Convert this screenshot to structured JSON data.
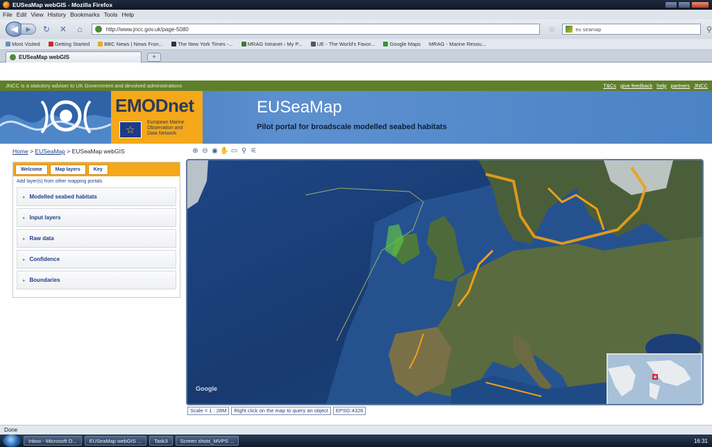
{
  "window": {
    "title": "EUSeaMap webGIS - Mozilla Firefox"
  },
  "menu": [
    "File",
    "Edit",
    "View",
    "History",
    "Bookmarks",
    "Tools",
    "Help"
  ],
  "nav": {
    "url": "http://www.jncc.gov.uk/page-5080",
    "search_value": "eu seamap"
  },
  "bookmarks": [
    "Most Visited",
    "Getting Started",
    "BBC News | News Fron...",
    "The New York Times -...",
    "MRAG Intranet › My P...",
    "UE - The World's Favor...",
    "Google Maps",
    "MRAG - Marine Resou..."
  ],
  "tab": {
    "label": "EUSeaMap webGIS",
    "new_tab": "+"
  },
  "jncc": {
    "notice": "JNCC is a statutory adviser to UK Government and devolved administrations",
    "links": [
      "T&Cs",
      "give feedback",
      "help",
      "partners",
      "JNCC"
    ]
  },
  "header": {
    "logo": "EMODnet",
    "logo_sub": [
      "European Marine",
      "Observation and",
      "Data Network"
    ],
    "title": "EUSeaMap",
    "subtitle": "Pilot portal for broadscale modelled seabed habitats"
  },
  "breadcrumb": {
    "home": "Home",
    "sep": ">",
    "section": "EUSeaMap",
    "current": "EUSeaMap webGIS"
  },
  "left_panel": {
    "tabs": [
      "Welcome",
      "Map layers",
      "Key"
    ],
    "add_link": "Add layer(s) from other mapping portals",
    "items": [
      "Modelled seabed habitats",
      "Input layers",
      "Raw data",
      "Confidence",
      "Boundaries"
    ]
  },
  "map": {
    "google_mark": "Google",
    "scale": "Scale = 1 : 28M",
    "hint": "Right click on the map to query an object",
    "projection": "EPSG:4326",
    "tools": [
      "zoom-in-icon",
      "zoom-out-icon",
      "globe-icon",
      "pan-icon",
      "print-icon",
      "query-icon",
      "measure-icon"
    ]
  },
  "status": {
    "text": "Done"
  },
  "taskbar": {
    "buttons": [
      "Inbox - Microsoft O...",
      "EUSeaMap webGIS ...",
      "Task3",
      "Screen shots_MVPS ..."
    ],
    "clock": "16:31"
  },
  "colors": {
    "jncc_green": "#5f7f2a",
    "emod_orange": "#f4a81a",
    "header_blue": "#4b83c6",
    "habitat_orange": "#f0a01a"
  }
}
